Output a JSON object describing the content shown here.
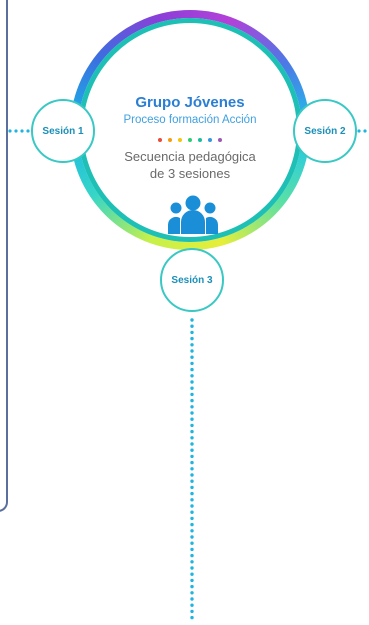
{
  "center": {
    "title": "Grupo Jóvenes",
    "subtitle": "Proceso formación Acción",
    "description_line1": "Secuencia pedagógica",
    "description_line2": "de 3 sesiones",
    "icon": "group-people-icon"
  },
  "sessions": [
    {
      "label": "Sesión 1"
    },
    {
      "label": "Sesión 2"
    },
    {
      "label": "Sesión 3"
    }
  ],
  "colors": {
    "title": "#2a7fd4",
    "subtitle": "#3fa0e0",
    "session_border": "#3ac8c4",
    "connector_dots": "#1fb5e0",
    "icon": "#1a8fd8",
    "palette_dots": [
      "#e74c3c",
      "#f39c12",
      "#f1c40f",
      "#2ecc71",
      "#1abc9c",
      "#3498db",
      "#9b59b6"
    ]
  }
}
